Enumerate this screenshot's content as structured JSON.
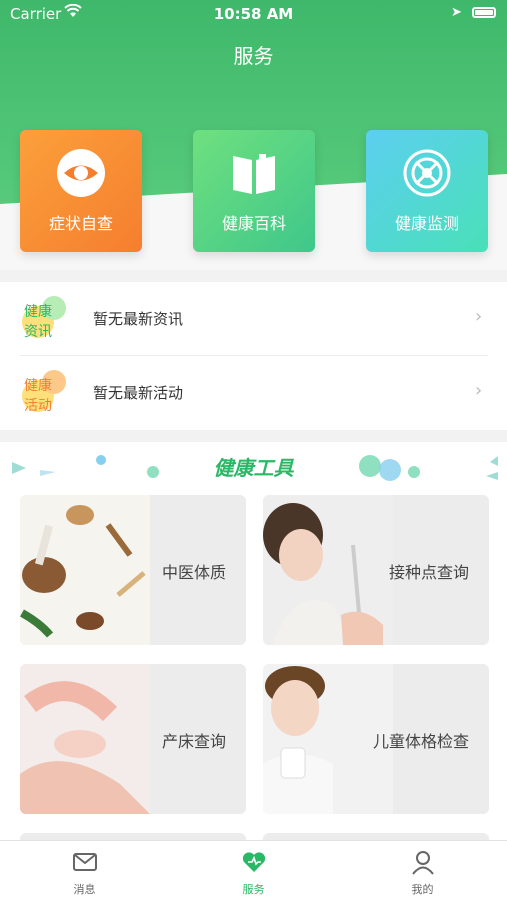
{
  "status_bar": {
    "carrier": "Carrier",
    "time": "10:58 AM"
  },
  "header": {
    "title": "服务"
  },
  "quick_actions": [
    {
      "label": "症状自查",
      "icon": "eye-icon"
    },
    {
      "label": "健康百科",
      "icon": "book-icon"
    },
    {
      "label": "健康监测",
      "icon": "monitor-icon"
    }
  ],
  "news": [
    {
      "badge_line1": "健康",
      "badge_line2": "资讯",
      "text": "暂无最新资讯"
    },
    {
      "badge_line1": "健康",
      "badge_line2": "活动",
      "text": "暂无最新活动"
    }
  ],
  "tools": {
    "title": "健康工具",
    "items": [
      {
        "label": "中医体质"
      },
      {
        "label": "接种点查询"
      },
      {
        "label": "产床查询"
      },
      {
        "label": "儿童体格检查"
      }
    ]
  },
  "tabbar": {
    "items": [
      {
        "label": "消息",
        "icon": "message-icon"
      },
      {
        "label": "服务",
        "icon": "heart-icon",
        "active": true
      },
      {
        "label": "我的",
        "icon": "user-icon"
      }
    ]
  },
  "colors": {
    "accent": "#2bb866",
    "orange": "#f57e2e",
    "teal": "#49e0b8"
  }
}
